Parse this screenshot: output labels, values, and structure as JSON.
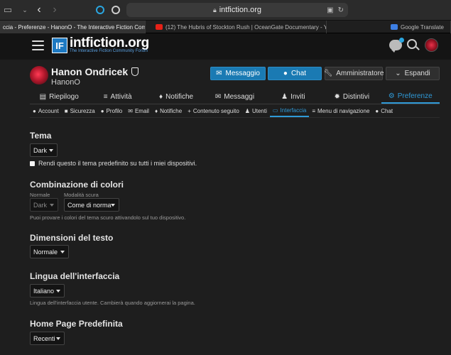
{
  "browser": {
    "url": "intfiction.org",
    "tabs": [
      {
        "title": "ccia - Preferenze - HanonO - The Interactive Fiction Com..."
      },
      {
        "title": "(12) The Hubris of Stockton Rush | OceanGate Documentary - Y..."
      },
      {
        "title": "Google Translate"
      }
    ]
  },
  "site": {
    "logo_box": "IF",
    "logo_text": "intfiction.org",
    "logo_sub": "The Interactive Fiction Community Forum"
  },
  "profile": {
    "display_name": "Hanon Ondricek",
    "username": "HanonO",
    "buttons": {
      "message": "Messaggio",
      "chat": "Chat",
      "admin": "Amministratore",
      "expand": "Espandi"
    }
  },
  "main_tabs": [
    {
      "icon": "list-icon",
      "label": "Riepilogo"
    },
    {
      "icon": "activity-icon",
      "label": "Attività"
    },
    {
      "icon": "bell-icon",
      "label": "Notifiche"
    },
    {
      "icon": "envelope-icon",
      "label": "Messaggi"
    },
    {
      "icon": "user-plus-icon",
      "label": "Inviti"
    },
    {
      "icon": "badge-icon",
      "label": "Distintivi"
    },
    {
      "icon": "gear-icon",
      "label": "Preferenze"
    }
  ],
  "sub_tabs": [
    {
      "icon": "user-icon",
      "label": "Account"
    },
    {
      "icon": "lock-icon",
      "label": "Sicurezza"
    },
    {
      "icon": "user-icon",
      "label": "Profilo"
    },
    {
      "icon": "envelope-icon",
      "label": "Email"
    },
    {
      "icon": "bell-icon",
      "label": "Notifiche"
    },
    {
      "icon": "plus-icon",
      "label": "Contenuto seguito"
    },
    {
      "icon": "users-icon",
      "label": "Utenti"
    },
    {
      "icon": "desktop-icon",
      "label": "Interfaccia"
    },
    {
      "icon": "menu-icon",
      "label": "Menu di navigazione"
    },
    {
      "icon": "chat-icon",
      "label": "Chat"
    }
  ],
  "settings": {
    "theme": {
      "title": "Tema",
      "value": "Dark",
      "checkbox_label": "Rendi questo il tema predefinito su tutti i miei dispositivi."
    },
    "color_scheme": {
      "title": "Combinazione di colori",
      "normal_label": "Normale",
      "normal_value": "Dark",
      "dark_label": "Modalità scura",
      "dark_value": "Come di norma",
      "hint": "Puoi provare i colori del tema scuro attivandolo sul tuo dispositivo."
    },
    "text_size": {
      "title": "Dimensioni del testo",
      "value": "Normale"
    },
    "language": {
      "title": "Lingua dell'interfaccia",
      "value": "Italiano",
      "hint": "Lingua dell'interfaccia utente. Cambierà quando aggiornerai la pagina."
    },
    "home_page": {
      "title": "Home Page Predefinita",
      "value": "Recenti"
    }
  },
  "colors": {
    "accent": "#2f9ad8",
    "button_blue": "#1a7ab3",
    "background": "#1e1e1e",
    "header": "#141414"
  }
}
